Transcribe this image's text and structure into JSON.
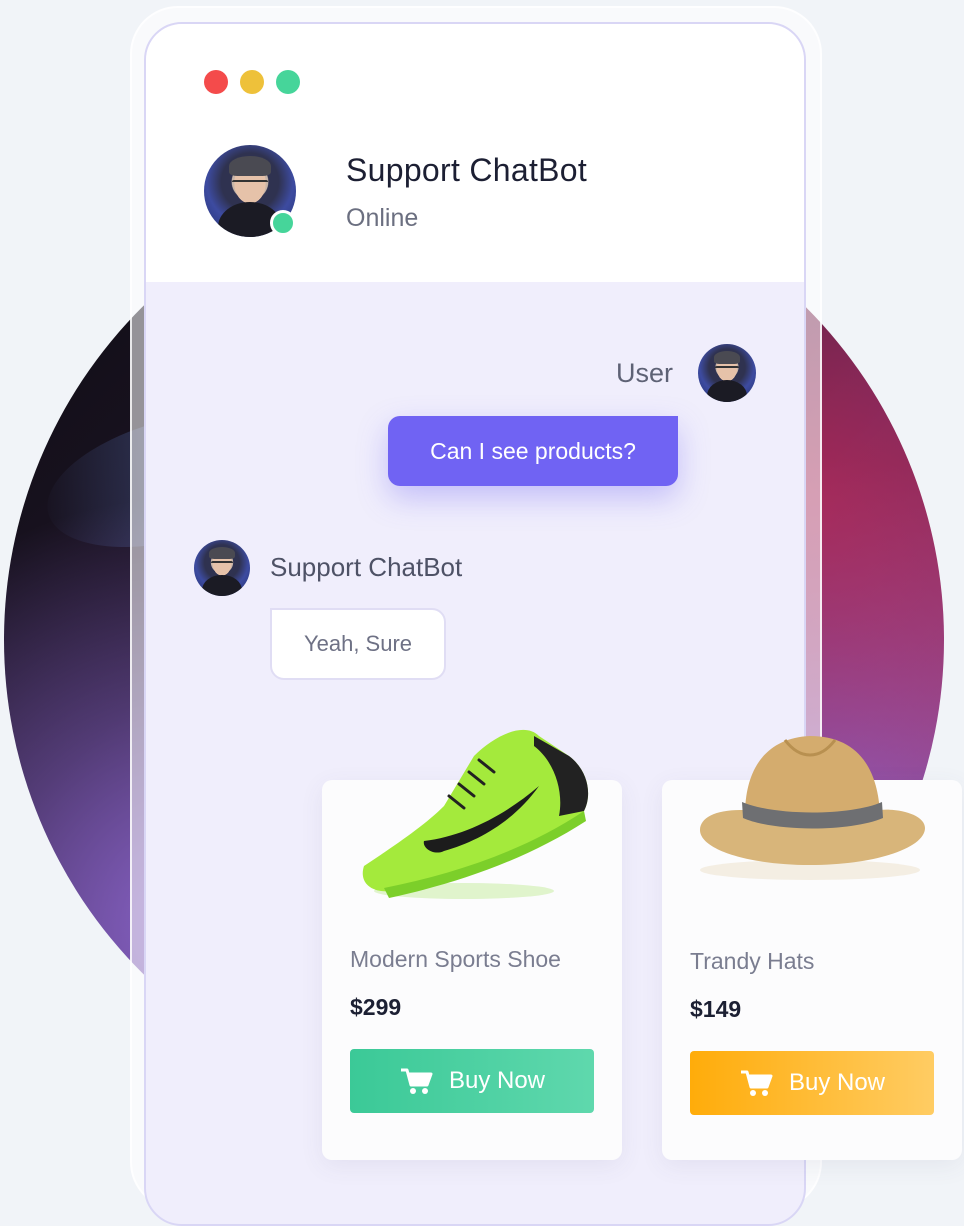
{
  "header": {
    "bot_name": "Support ChatBot",
    "status": "Online",
    "window_buttons": [
      "close",
      "minimize",
      "maximize"
    ]
  },
  "messages": [
    {
      "sender": "User",
      "text": "Can I see products?"
    },
    {
      "sender": "Support ChatBot",
      "text": "Yeah, Sure"
    }
  ],
  "products": [
    {
      "name": "Modern Sports Shoe",
      "price": "$299",
      "button": "Buy Now",
      "button_color": "#3bc997",
      "icon": "cart-icon"
    },
    {
      "name": "Trandy Hats",
      "price": "$149",
      "button": "Buy Now",
      "button_color": "#ffac0a",
      "icon": "cart-icon"
    }
  ],
  "colors": {
    "accent": "#7063f3",
    "online": "#46d59a",
    "close": "#f44b4b",
    "minimize": "#eec13a",
    "maximize": "#46d59a"
  }
}
